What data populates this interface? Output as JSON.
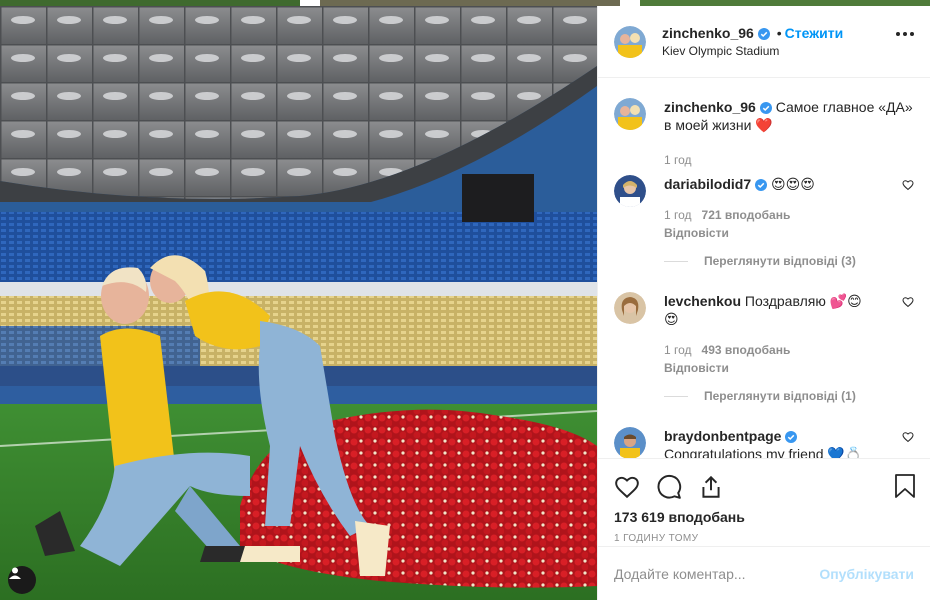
{
  "post": {
    "username": "zinchenko_96",
    "dot": "•",
    "follow_label": "Стежити",
    "location": "Kiev Olympic Stadium",
    "caption": "Самое главное «ДА» в моей жизни",
    "caption_emoji": "❤️",
    "caption_age": "1 год"
  },
  "comments": [
    {
      "username": "dariabilodid7",
      "text": "",
      "emoji": "😍😍😍",
      "age": "1 год",
      "likes": "721 вподобань",
      "reply": "Відповісти",
      "view_replies": "Переглянути відповіді (3)"
    },
    {
      "username": "levchenkou",
      "text": "Поздравляю",
      "emoji": "💕😊",
      "emoji2": "😍",
      "age": "1 год",
      "likes": "493 вподобань",
      "reply": "Відповісти",
      "view_replies": "Переглянути відповіді (1)"
    },
    {
      "username": "braydonbentpage",
      "text": "Congratulations my friend",
      "emoji": "💙💍"
    }
  ],
  "actions": {
    "likes": "173 619 вподобань",
    "timestamp": "1 ГОДИНУ ТОМУ"
  },
  "add_comment": {
    "placeholder": "Додайте коментар...",
    "publish_label": "Опублікувати"
  },
  "icons": [
    "heart-icon",
    "comment-icon",
    "share-icon",
    "bookmark-icon",
    "more-options-icon",
    "verified-badge-icon",
    "user-tags-icon"
  ],
  "colors": {
    "accent": "#0095f6",
    "publish_disabled": "#b2dffc",
    "verified": "#3897f0"
  }
}
